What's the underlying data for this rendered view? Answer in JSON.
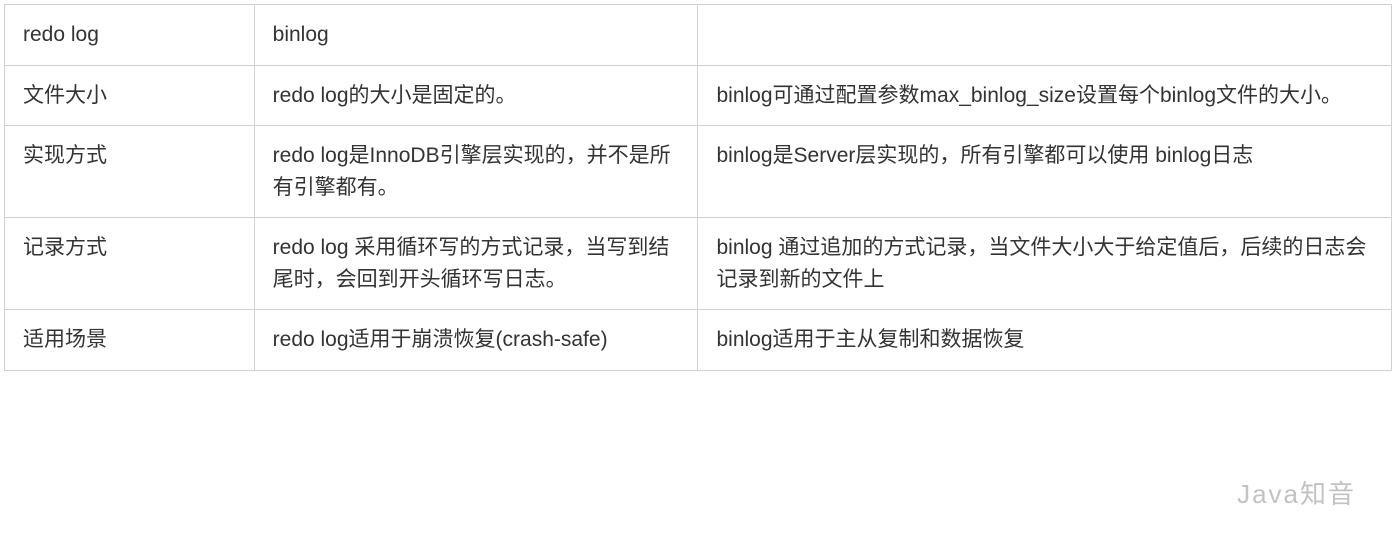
{
  "table": {
    "rows": [
      {
        "col1": "redo log",
        "col2": "binlog",
        "col3": ""
      },
      {
        "col1": "文件大小",
        "col2": "redo log的大小是固定的。",
        "col3": "binlog可通过配置参数max_binlog_size设置每个binlog文件的大小。"
      },
      {
        "col1": "实现方式",
        "col2": "redo log是InnoDB引擎层实现的，并不是所有引擎都有。",
        "col3": "binlog是Server层实现的，所有引擎都可以使用 binlog日志"
      },
      {
        "col1": "记录方式",
        "col2": "redo log 采用循环写的方式记录，当写到结尾时，会回到开头循环写日志。",
        "col3": "binlog 通过追加的方式记录，当文件大小大于给定值后，后续的日志会记录到新的文件上"
      },
      {
        "col1": "适用场景",
        "col2": "redo log适用于崩溃恢复(crash-safe)",
        "col3": "binlog适用于主从复制和数据恢复"
      }
    ]
  },
  "watermark": "Java知音"
}
